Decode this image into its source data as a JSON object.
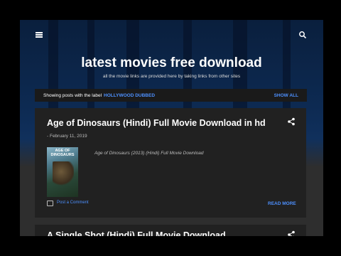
{
  "header": {
    "title": "latest movies free download",
    "description": "all the movie links are provided here by taking links from other sites"
  },
  "label_bar": {
    "prefix": "Showing posts with the label",
    "label": "HOLLYWOOD DUBBED",
    "show_all": "SHOW ALL"
  },
  "posts": [
    {
      "title": "Age of Dinosaurs (Hindi) Full Movie Download in hd",
      "date": "- February 11, 2019",
      "thumbnail_title": "AGE OF DINOSAURS",
      "excerpt": "Age of Dinosaurs (2013) (Hindi) Full Movie Download",
      "comment_link": "Post a Comment",
      "read_more": "READ MORE"
    },
    {
      "title": "A Single Shot (Hindi) Full Movie Download"
    }
  ],
  "icons": {
    "menu": "hamburger-icon",
    "search": "search-icon",
    "share": "share-icon",
    "comment": "comment-icon"
  },
  "colors": {
    "accent": "#4d90fe",
    "card_bg": "#212121",
    "header_bg": "#0d2a52"
  }
}
